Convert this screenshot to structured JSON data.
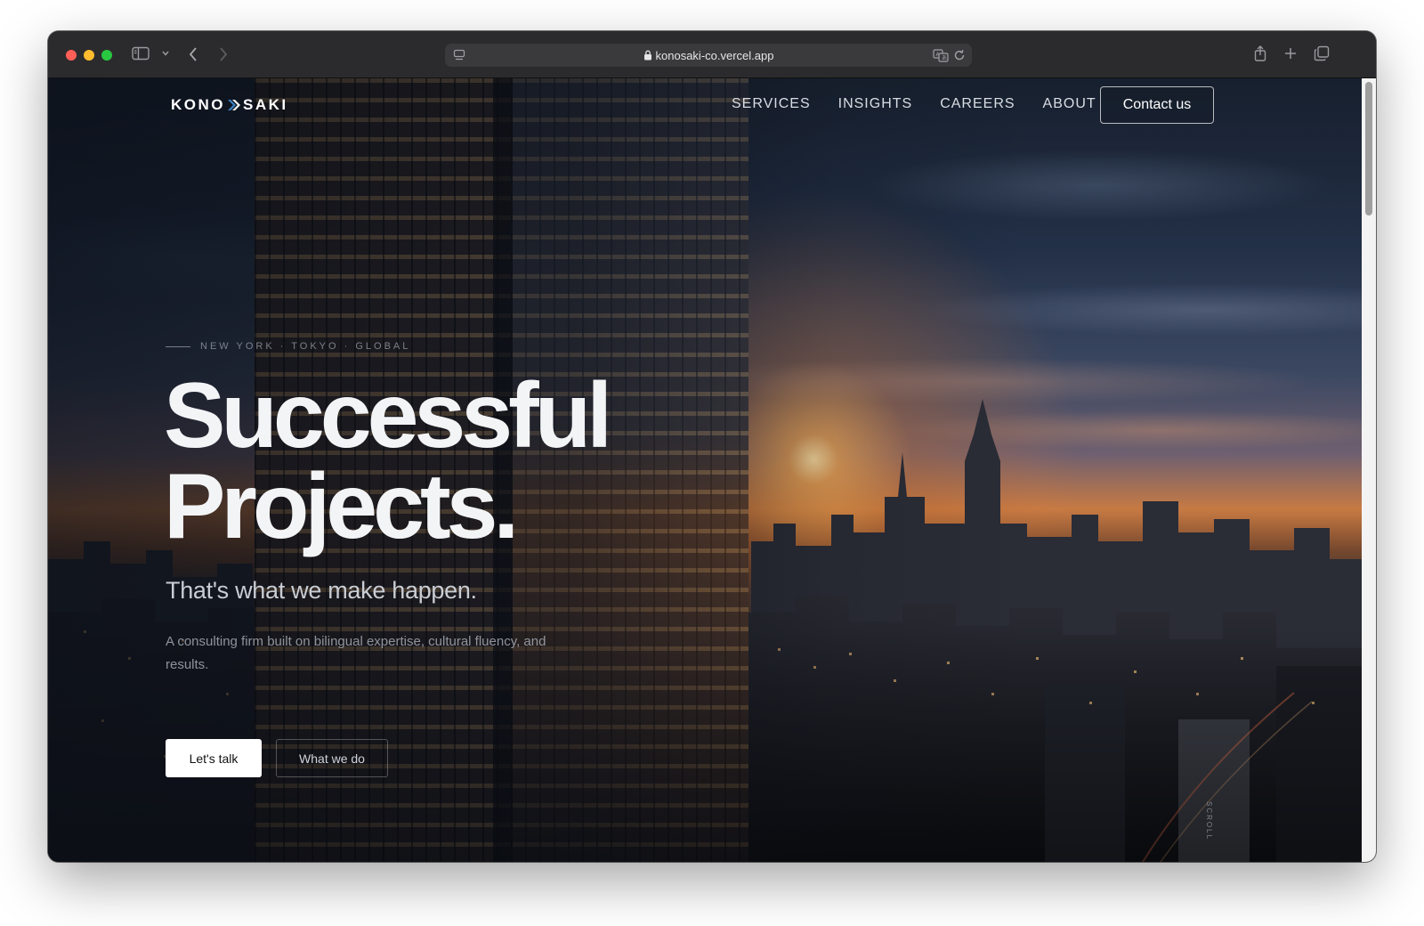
{
  "browser": {
    "url": "konosaki-co.vercel.app"
  },
  "site": {
    "logo_left": "KONO",
    "logo_right": "SAKI",
    "nav": [
      "SERVICES",
      "INSIGHTS",
      "CAREERS",
      "ABOUT"
    ],
    "contact_label": "Contact us"
  },
  "hero": {
    "eyebrow": "NEW YORK · TOKYO · GLOBAL",
    "headline_line1": "Successful",
    "headline_line2": "Projects.",
    "subheadline": "That's what we make happen.",
    "description": "A consulting firm built on bilingual expertise, cultural fluency, and results.",
    "primary_cta": "Let's talk",
    "secondary_cta": "What we do",
    "scroll_label": "SCROLL"
  }
}
